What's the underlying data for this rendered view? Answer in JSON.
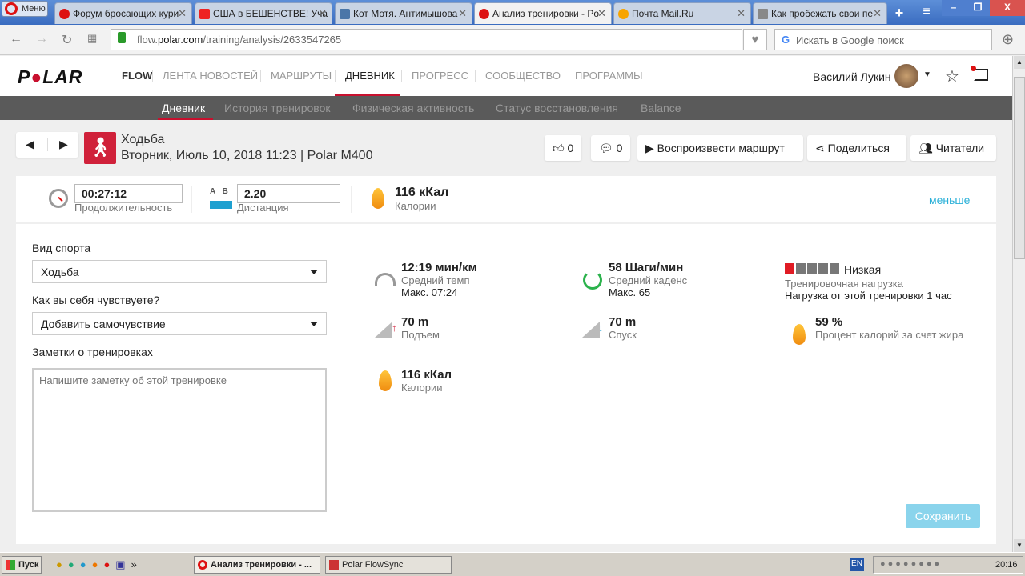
{
  "browser": {
    "menu": "Меню",
    "tabs": [
      {
        "label": "Форум бросающих кури",
        "color": "#d11"
      },
      {
        "label": "США в БЕШЕНСТВЕ! Уча",
        "color": "#e22"
      },
      {
        "label": "Кот Мотя. Антимышова",
        "color": "#4a76a8"
      },
      {
        "label": "Анализ тренировки - Po",
        "color": "#d11"
      },
      {
        "label": "Почта Mail.Ru",
        "color": "#f7a400"
      },
      {
        "label": "Как пробежать свои пе",
        "color": "#888"
      }
    ],
    "url_prefix": "flow.",
    "url_domain": "polar.com",
    "url_path": "/training/analysis/2633547265",
    "search_placeholder": "Искать в Google поиск"
  },
  "header": {
    "logo": "POLAR",
    "flow": "FLOW",
    "nav": [
      "ЛЕНТА НОВОСТЕЙ",
      "МАРШРУТЫ",
      "ДНЕВНИК",
      "ПРОГРЕСС",
      "СООБЩЕСТВО",
      "ПРОГРАММЫ"
    ],
    "user": "Василий Лукин"
  },
  "subnav": [
    "Дневник",
    "История тренировок",
    "Физическая активность",
    "Статус восстановления",
    "Balance"
  ],
  "training": {
    "sport": "Ходьба",
    "date": "Вторник, Июль 10, 2018 11:23 | Polar M400"
  },
  "actions": {
    "likes": "0",
    "comments": "0",
    "play": "Воспроизвести маршрут",
    "share": "Поделиться",
    "readers": "Читатели"
  },
  "summary": {
    "duration": "00:27:12",
    "duration_label": "Продолжительность",
    "ab_a": "A",
    "ab_b": "B",
    "distance": "2.20",
    "distance_label": "Дистанция",
    "calories": "116 кКал",
    "calories_label": "Калории",
    "less": "меньше"
  },
  "form": {
    "sport_label": "Вид спорта",
    "sport_value": "Ходьба",
    "feel_label": "Как вы себя чувствуете?",
    "feel_value": "Добавить самочувствие",
    "notes_label": "Заметки о тренировках",
    "notes_placeholder": "Напишите заметку об этой тренировке",
    "save": "Сохранить"
  },
  "stats": {
    "pace": {
      "value": "12:19 мин/км",
      "label": "Средний темп",
      "max": "Макс. 07:24"
    },
    "cadence": {
      "value": "58 Шаги/мин",
      "label": "Средний каденс",
      "max": "Макс. 65"
    },
    "load": {
      "level": "Низкая",
      "level_of_5": 1,
      "label": "Тренировочная нагрузка",
      "detail": "Нагрузка от этой тренировки 1 час"
    },
    "ascent": {
      "value": "70 m",
      "label": "Подъем"
    },
    "descent": {
      "value": "70 m",
      "label": "Спуск"
    },
    "fat": {
      "value": "59 %",
      "label": "Процент калорий за счет жира"
    },
    "calories": {
      "value": "116 кКал",
      "label": "Калории"
    }
  },
  "taskbar": {
    "start": "Пуск",
    "items": [
      "Анализ тренировки - ...",
      "Polar FlowSync"
    ],
    "lang": "EN",
    "time": "20:16"
  }
}
